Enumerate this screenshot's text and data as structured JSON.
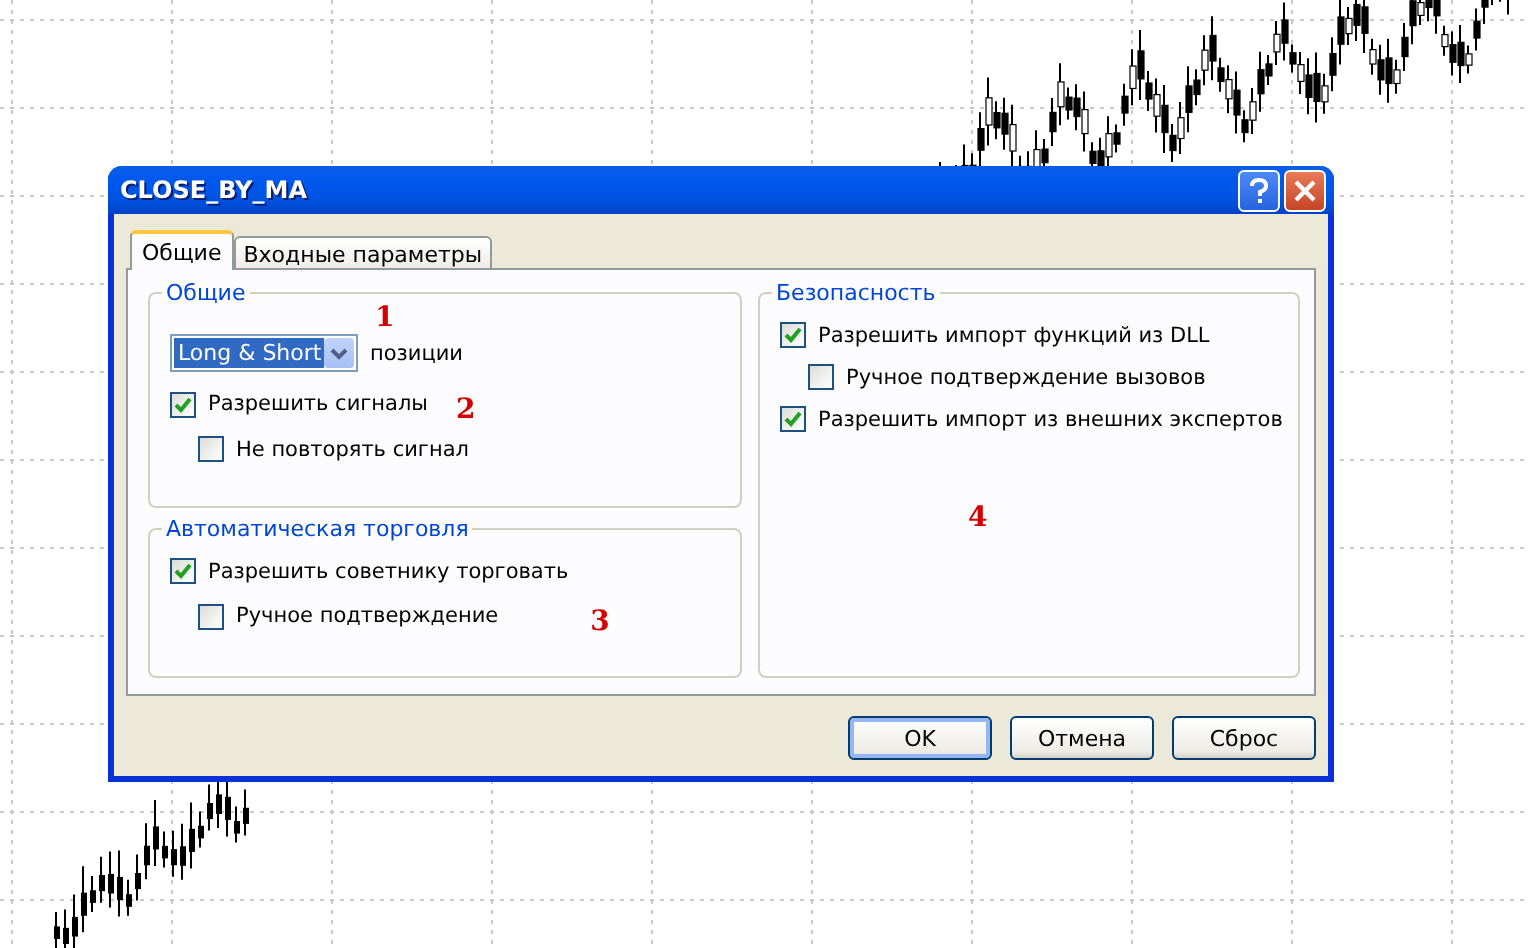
{
  "window": {
    "title": "CLOSE_BY_MA"
  },
  "tabs": [
    {
      "label": "Общие",
      "selected": true
    },
    {
      "label": "Входные параметры",
      "selected": false
    }
  ],
  "columns": [
    {
      "groups": [
        {
          "title": "Общие",
          "items": [
            {
              "kind": "combo",
              "value": "Long & Short",
              "label": "позиции",
              "annotation": "1"
            },
            {
              "kind": "checkbox",
              "label": "Разрешить сигналы",
              "checked": true,
              "annotation": "2",
              "children": [
                {
                  "kind": "checkbox",
                  "label": "Не повторять сигнал",
                  "checked": false
                }
              ]
            }
          ]
        },
        {
          "title": "Автоматическая торговля",
          "items": [
            {
              "kind": "checkbox",
              "label": "Разрешить советнику торговать",
              "checked": true,
              "children": [
                {
                  "kind": "checkbox",
                  "label": "Ручное подтверждение",
                  "checked": false,
                  "annotation": "3"
                }
              ]
            }
          ]
        }
      ]
    },
    {
      "groups": [
        {
          "title": "Безопасность",
          "annotation": "4",
          "items": [
            {
              "kind": "checkbox",
              "label": "Разрешить импорт функций из DLL",
              "checked": true,
              "children": [
                {
                  "kind": "checkbox",
                  "label": "Ручное подтверждение вызовов",
                  "checked": false
                }
              ]
            },
            {
              "kind": "checkbox",
              "label": "Разрешить импорт из внешних экспертов",
              "checked": true
            }
          ]
        }
      ]
    }
  ],
  "buttons": [
    {
      "label": "OK",
      "default": true
    },
    {
      "label": "Отмена",
      "default": false
    },
    {
      "label": "Сброс",
      "default": false
    }
  ]
}
